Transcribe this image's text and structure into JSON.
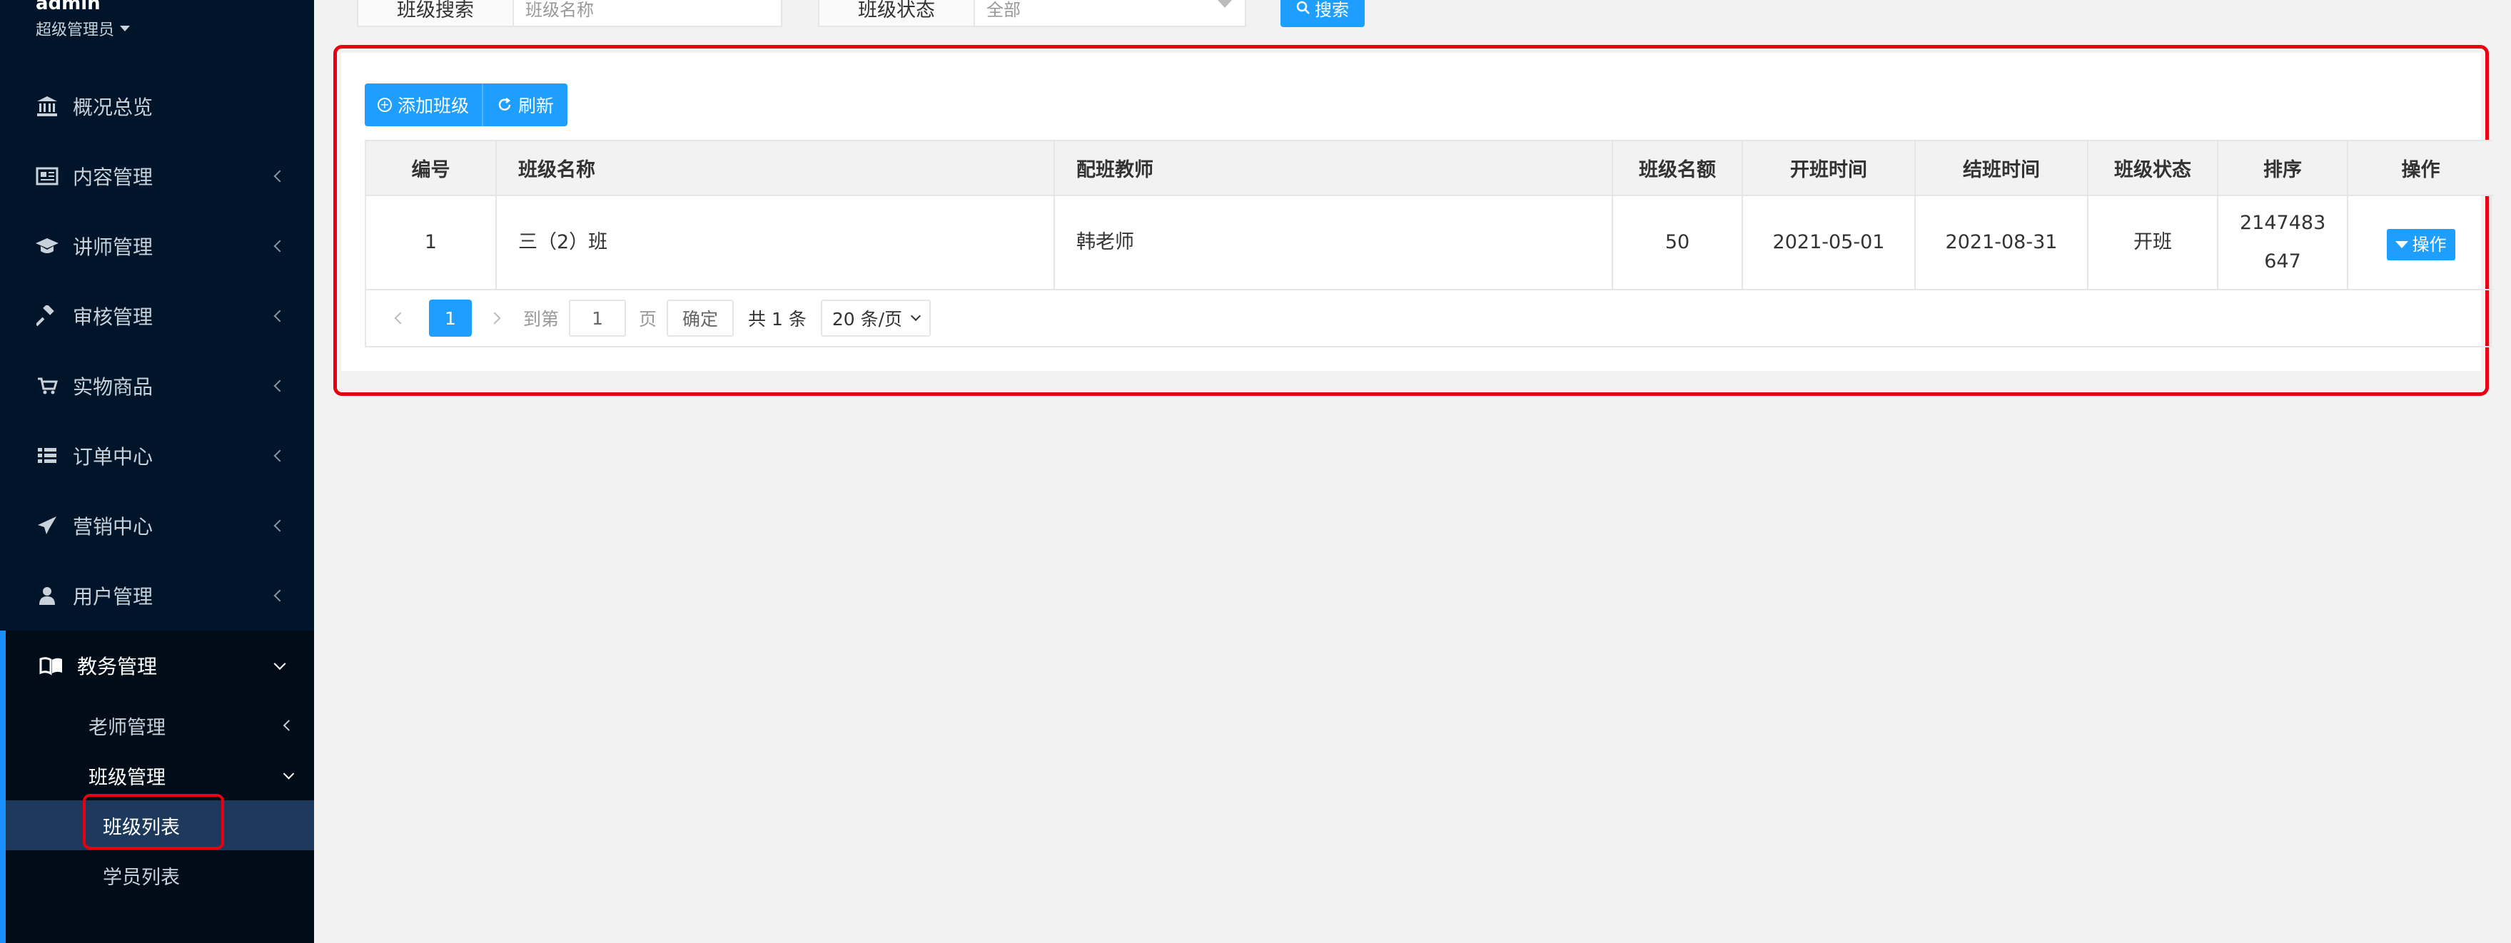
{
  "user": {
    "name": "admin",
    "role": "超级管理员"
  },
  "sidebar": {
    "items": [
      {
        "label": "概况总览",
        "icon": "bank-icon"
      },
      {
        "label": "内容管理",
        "icon": "newspaper-icon"
      },
      {
        "label": "讲师管理",
        "icon": "graduation-cap-icon"
      },
      {
        "label": "审核管理",
        "icon": "gavel-icon"
      },
      {
        "label": "实物商品",
        "icon": "cart-icon"
      },
      {
        "label": "订单中心",
        "icon": "list-icon"
      },
      {
        "label": "营销中心",
        "icon": "paper-plane-icon"
      },
      {
        "label": "用户管理",
        "icon": "user-icon"
      },
      {
        "label": "教务管理",
        "icon": "book-icon"
      }
    ],
    "submenu": {
      "teacher": "老师管理",
      "class": "班级管理",
      "class_list": "班级列表",
      "student_list": "学员列表"
    }
  },
  "search": {
    "class_label": "班级搜索",
    "class_placeholder": "班级名称",
    "status_label": "班级状态",
    "status_value": "全部",
    "button": "搜索"
  },
  "toolbar": {
    "add": "添加班级",
    "refresh": "刷新"
  },
  "table": {
    "headers": [
      "编号",
      "班级名称",
      "配班教师",
      "班级名额",
      "开班时间",
      "结班时间",
      "班级状态",
      "排序",
      "操作"
    ],
    "rows": [
      {
        "id": "1",
        "name": "三（2）班",
        "teacher": "韩老师",
        "quota": "50",
        "start": "2021-05-01",
        "end": "2021-08-31",
        "status": "开班",
        "sort_line1": "2147483",
        "sort_line2": "647",
        "action": "操作"
      }
    ]
  },
  "pager": {
    "current": "1",
    "goto": "到第",
    "page_input": "1",
    "page_unit": "页",
    "confirm": "确定",
    "total": "共 1 条",
    "size": "20 条/页"
  },
  "colors": {
    "sidebar_bg": "#001529",
    "accent": "#1e9fff",
    "highlight": "#e60012"
  }
}
